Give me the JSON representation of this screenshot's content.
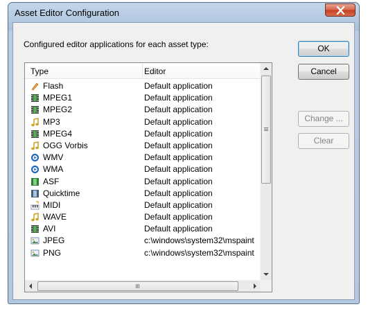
{
  "window": {
    "title": "Asset Editor Configuration"
  },
  "caption": "Configured editor applications for each asset type:",
  "list": {
    "columns": [
      "Type",
      "Editor"
    ],
    "rows": [
      {
        "type": "Flash",
        "editor": "Default application",
        "icon": "flash-icon"
      },
      {
        "type": "MPEG1",
        "editor": "Default application",
        "icon": "video-icon"
      },
      {
        "type": "MPEG2",
        "editor": "Default application",
        "icon": "video-icon"
      },
      {
        "type": "MP3",
        "editor": "Default application",
        "icon": "audio-icon"
      },
      {
        "type": "MPEG4",
        "editor": "Default application",
        "icon": "video-icon"
      },
      {
        "type": "OGG Vorbis",
        "editor": "Default application",
        "icon": "audio-icon"
      },
      {
        "type": "WMV",
        "editor": "Default application",
        "icon": "media-player-icon"
      },
      {
        "type": "WMA",
        "editor": "Default application",
        "icon": "media-player-icon"
      },
      {
        "type": "ASF",
        "editor": "Default application",
        "icon": "video-green-icon"
      },
      {
        "type": "Quicktime",
        "editor": "Default application",
        "icon": "quicktime-icon"
      },
      {
        "type": "MIDI",
        "editor": "Default application",
        "icon": "midi-icon"
      },
      {
        "type": "WAVE",
        "editor": "Default application",
        "icon": "audio-icon"
      },
      {
        "type": "AVI",
        "editor": "Default application",
        "icon": "video-icon"
      },
      {
        "type": "JPEG",
        "editor": "c:\\windows\\system32\\mspaint",
        "icon": "image-icon"
      },
      {
        "type": "PNG",
        "editor": "c:\\windows\\system32\\mspaint",
        "icon": "image-icon"
      }
    ]
  },
  "buttons": {
    "ok": "OK",
    "cancel": "Cancel",
    "change": "Change ...",
    "clear": "Clear"
  },
  "colors": {
    "audio": "#c9a227",
    "video": "#2e7d32",
    "media": "#1565c0",
    "flash": "#f2a341",
    "close": "#c43e22"
  }
}
